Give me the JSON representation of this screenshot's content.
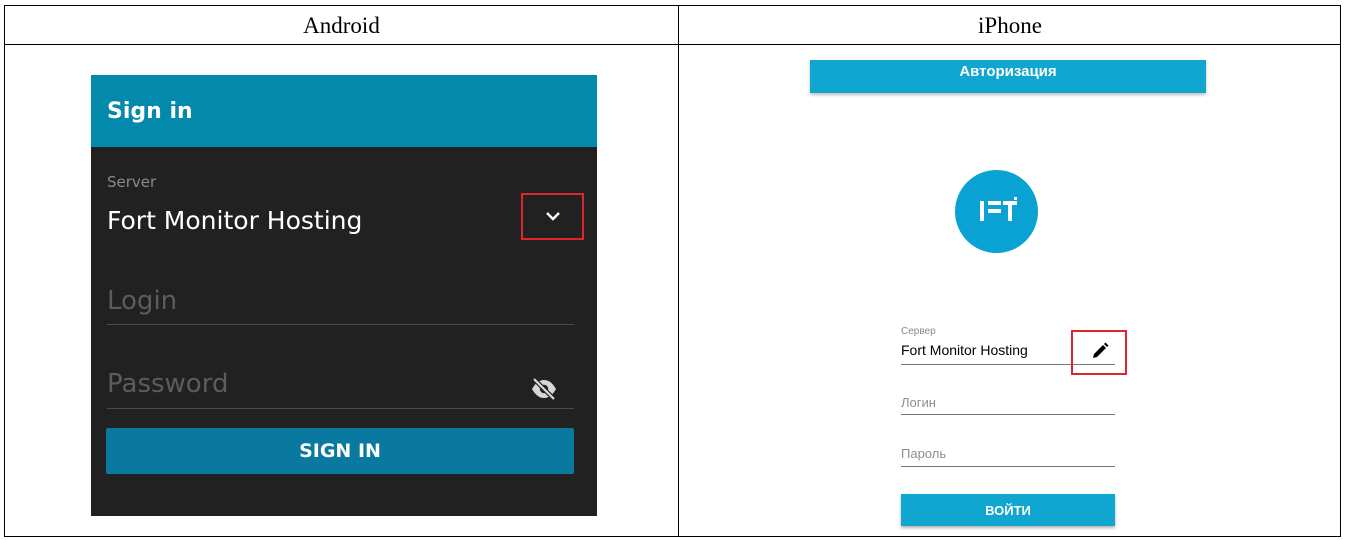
{
  "table": {
    "col_android": "Android",
    "col_iphone": "iPhone"
  },
  "android": {
    "title": "Sign in",
    "server_label": "Server",
    "server_value": "Fort Monitor Hosting",
    "login_placeholder": "Login",
    "password_placeholder": "Password",
    "signin_button": "SIGN IN",
    "chevron_icon": "chevron-down-icon",
    "eye_icon": "eye-off-icon",
    "colors": {
      "header": "#0289ac",
      "background": "#212121",
      "button": "#0a79a0",
      "highlight": "#e0242b"
    }
  },
  "iphone": {
    "title": "Авторизация",
    "server_label": "Сервер",
    "server_value": "Fort Monitor Hosting",
    "login_placeholder": "Логин",
    "password_placeholder": "Пароль",
    "signin_button": "ВОЙТИ",
    "logo_icon": "fort-logo-icon",
    "pencil_icon": "pencil-icon",
    "colors": {
      "header": "#10a6cf",
      "logo": "#0aa1d3",
      "button": "#10a6cf",
      "highlight": "#e0242b"
    }
  }
}
